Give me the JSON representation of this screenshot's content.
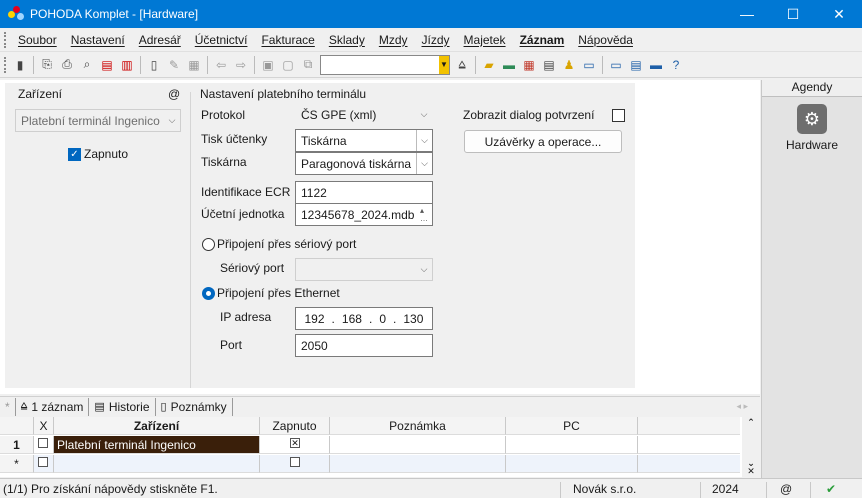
{
  "window": {
    "title": "POHODA Komplet - [Hardware]",
    "controls": {
      "minimize": "—",
      "maximize": "☐",
      "close": "✕"
    }
  },
  "menu": [
    "Soubor",
    "Nastavení",
    "Adresář",
    "Účetnictví",
    "Fakturace",
    "Sklady",
    "Mzdy",
    "Jízdy",
    "Majetek",
    "Záznam",
    "Nápověda"
  ],
  "toolbar": {
    "icons": [
      "record-icon",
      "copy-icon",
      "print-icon",
      "print-preview-icon",
      "pdf-icon",
      "pdf-send-icon",
      "new-record-icon",
      "edit-dropdown-icon",
      "table-dropdown-icon",
      "back-icon",
      "forward-dropdown-icon",
      "save-icon",
      "delete-icon",
      "duplicate-icon",
      "search-combo",
      "filter-icon",
      "folder-dropdown-icon",
      "money-icon",
      "calc-icon",
      "settings-icon",
      "user-icon",
      "iban-icon",
      "window-icon",
      "card-icon",
      "list-icon",
      "help-dropdown-icon"
    ],
    "search_value": ""
  },
  "device_panel": {
    "title": "Zařízení",
    "at_symbol": "@",
    "device_select": "Platební terminál Ingenico",
    "enabled_label": "Zapnuto",
    "enabled": true
  },
  "terminal_settings": {
    "title": "Nastavení platebního terminálu",
    "protocol_label": "Protokol",
    "protocol_value": "ČS GPE (xml)",
    "receipt_print_label": "Tisk účtenky",
    "receipt_print_value": "Tiskárna",
    "printer_label": "Tiskárna",
    "printer_value": "Paragonová tiskárna",
    "ecr_id_label": "Identifikace ECR",
    "ecr_id_value": "1122",
    "accounting_unit_label": "Účetní jednotka",
    "accounting_unit_value": "12345678_2024.mdb",
    "confirm_dialog_label": "Zobrazit dialog potvrzení",
    "confirm_dialog": false,
    "closings_button": "Uzávěrky a operace...",
    "serial_radio_label": "Připojení přes sériový port",
    "serial_port_label": "Sériový port",
    "serial_port_value": "",
    "ethernet_radio_label": "Připojení přes Ethernet",
    "ip_label": "IP adresa",
    "ip": [
      "192",
      "168",
      "0",
      "130"
    ],
    "port_label": "Port",
    "port_value": "2050"
  },
  "agenda": {
    "header": "Agendy",
    "item_label": "Hardware"
  },
  "tabs": [
    {
      "icon": "*",
      "label": ""
    },
    {
      "icon": "filter-icon",
      "label": "1 záznam"
    },
    {
      "icon": "history-icon",
      "label": "Historie"
    },
    {
      "icon": "notes-icon",
      "label": "Poznámky"
    }
  ],
  "table": {
    "columns": [
      "",
      "X",
      "Zařízení",
      "Zapnuto",
      "Poznámka",
      "PC"
    ],
    "rows": [
      {
        "num": "1",
        "x": false,
        "device": "Platební terminál Ingenico",
        "enabled": true,
        "note": "",
        "pc": ""
      },
      {
        "num": "*",
        "x": false,
        "device": "",
        "enabled": false,
        "note": "",
        "pc": ""
      }
    ]
  },
  "status": {
    "help_text": "(1/1) Pro získání nápovědy stiskněte F1.",
    "company": "Novák s.r.o.",
    "year": "2024",
    "at": "@",
    "check": "✔"
  }
}
